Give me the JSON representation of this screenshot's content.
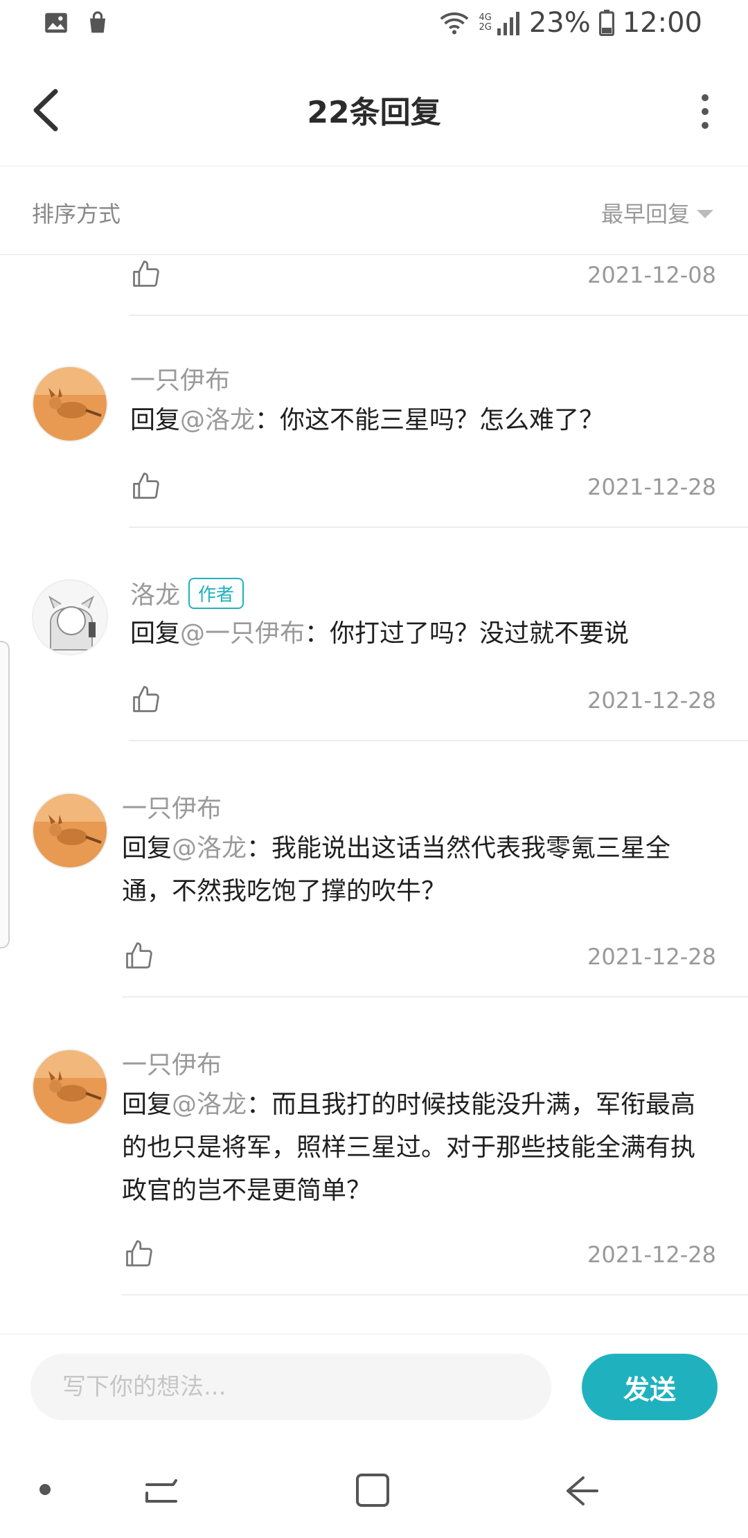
{
  "status": {
    "battery": "23%",
    "time": "12:00",
    "net_top": "4G",
    "net_bottom": "2G"
  },
  "header": {
    "title": "22条回复"
  },
  "sort": {
    "label": "排序方式",
    "value": "最早回复"
  },
  "partial_item": {
    "date": "2021-12-08"
  },
  "comments": [
    {
      "name": "一只伊布",
      "reply_prefix": "回复",
      "mention": "@洛龙",
      "text": "：你这不能三星吗？怎么难了？",
      "date": "2021-12-28",
      "author": false
    },
    {
      "name": "洛龙",
      "badge": "作者",
      "reply_prefix": "回复",
      "mention": "@一只伊布",
      "text": "：你打过了吗？没过就不要说",
      "date": "2021-12-28",
      "author": true
    },
    {
      "name": "一只伊布",
      "reply_prefix": "回复",
      "mention": "@洛龙",
      "text": "：我能说出这话当然代表我零氪三星全通，不然我吃饱了撑的吹牛？",
      "date": "2021-12-28",
      "author": false
    },
    {
      "name": "一只伊布",
      "reply_prefix": "回复",
      "mention": "@洛龙",
      "text": "：而且我打的时候技能没升满，军衔最高的也只是将军，照样三星过。对于那些技能全满有执政官的岂不是更简单？",
      "date": "2021-12-28",
      "author": false
    }
  ],
  "composer": {
    "placeholder": "写下你的想法...",
    "send_label": "发送"
  },
  "colors": {
    "accent": "#1fb2be",
    "meta_text": "#999999"
  }
}
